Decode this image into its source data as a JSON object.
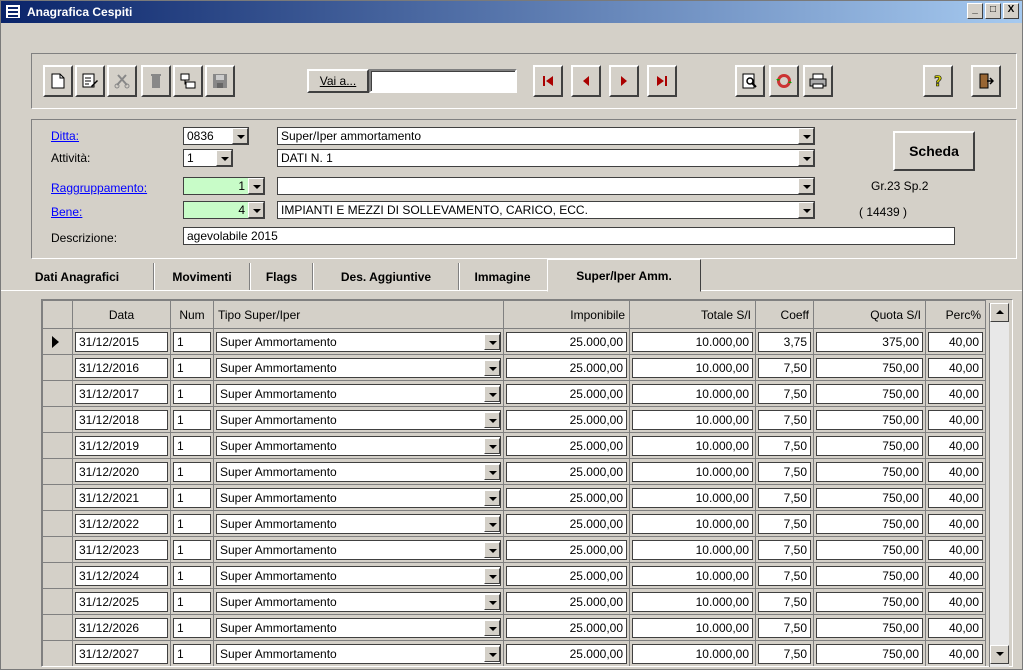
{
  "window": {
    "title": "Anagrafica Cespiti",
    "buttons": [
      "_",
      "□",
      "X"
    ]
  },
  "toolbar": {
    "buttons": [
      {
        "name": "new-icon"
      },
      {
        "name": "edit-icon"
      },
      {
        "name": "cut-icon"
      },
      {
        "name": "trash-icon"
      },
      {
        "name": "duplicate-icon"
      },
      {
        "name": "save-icon"
      }
    ],
    "vai_label": "Vai a...",
    "vai_value": "",
    "nav": [
      "first-record-icon",
      "previous-record-icon",
      "next-record-icon",
      "last-record-icon"
    ],
    "tools": [
      "preview-icon",
      "refresh-icon",
      "print-icon",
      "help-icon",
      "exit-icon"
    ]
  },
  "header": {
    "ditta_label": "Ditta:",
    "ditta_value": "0836",
    "ditta_desc": "Super/Iper ammortamento",
    "attivita_label": "Attività:",
    "attivita_value": "1",
    "attivita_desc": "DATI N.  1",
    "raggruppamento_label": "Raggruppamento:",
    "raggruppamento_value": "1",
    "raggruppamento_desc": "",
    "bene_label": "Bene:",
    "bene_value": "4",
    "bene_desc": "IMPIANTI E MEZZI DI SOLLEVAMENTO, CARICO, ECC.",
    "descrizione_label": "Descrizione:",
    "descrizione_value": "agevolabile 2015",
    "scheda_label": "Scheda",
    "gruppo": "Gr.23 Sp.2",
    "codice": "(      14439     )"
  },
  "tabs": [
    {
      "label": "Dati Anagrafici"
    },
    {
      "label": "Movimenti"
    },
    {
      "label": "Flags"
    },
    {
      "label": "Des. Aggiuntive"
    },
    {
      "label": "Immagine"
    },
    {
      "label": "Super/Iper Amm."
    }
  ],
  "grid": {
    "columns": [
      "Data",
      "Num",
      "Tipo Super/Iper",
      "Imponibile",
      "Totale S/I",
      "Coeff",
      "Quota S/I",
      "Perc%"
    ],
    "rows": [
      {
        "data": "31/12/2015",
        "num": "1",
        "tipo": "Super Ammortamento",
        "imponibile": "25.000,00",
        "totale": "10.000,00",
        "coeff": "3,75",
        "quota": "375,00",
        "perc": "40,00"
      },
      {
        "data": "31/12/2016",
        "num": "1",
        "tipo": "Super Ammortamento",
        "imponibile": "25.000,00",
        "totale": "10.000,00",
        "coeff": "7,50",
        "quota": "750,00",
        "perc": "40,00"
      },
      {
        "data": "31/12/2017",
        "num": "1",
        "tipo": "Super Ammortamento",
        "imponibile": "25.000,00",
        "totale": "10.000,00",
        "coeff": "7,50",
        "quota": "750,00",
        "perc": "40,00"
      },
      {
        "data": "31/12/2018",
        "num": "1",
        "tipo": "Super Ammortamento",
        "imponibile": "25.000,00",
        "totale": "10.000,00",
        "coeff": "7,50",
        "quota": "750,00",
        "perc": "40,00"
      },
      {
        "data": "31/12/2019",
        "num": "1",
        "tipo": "Super Ammortamento",
        "imponibile": "25.000,00",
        "totale": "10.000,00",
        "coeff": "7,50",
        "quota": "750,00",
        "perc": "40,00"
      },
      {
        "data": "31/12/2020",
        "num": "1",
        "tipo": "Super Ammortamento",
        "imponibile": "25.000,00",
        "totale": "10.000,00",
        "coeff": "7,50",
        "quota": "750,00",
        "perc": "40,00"
      },
      {
        "data": "31/12/2021",
        "num": "1",
        "tipo": "Super Ammortamento",
        "imponibile": "25.000,00",
        "totale": "10.000,00",
        "coeff": "7,50",
        "quota": "750,00",
        "perc": "40,00"
      },
      {
        "data": "31/12/2022",
        "num": "1",
        "tipo": "Super Ammortamento",
        "imponibile": "25.000,00",
        "totale": "10.000,00",
        "coeff": "7,50",
        "quota": "750,00",
        "perc": "40,00"
      },
      {
        "data": "31/12/2023",
        "num": "1",
        "tipo": "Super Ammortamento",
        "imponibile": "25.000,00",
        "totale": "10.000,00",
        "coeff": "7,50",
        "quota": "750,00",
        "perc": "40,00"
      },
      {
        "data": "31/12/2024",
        "num": "1",
        "tipo": "Super Ammortamento",
        "imponibile": "25.000,00",
        "totale": "10.000,00",
        "coeff": "7,50",
        "quota": "750,00",
        "perc": "40,00"
      },
      {
        "data": "31/12/2025",
        "num": "1",
        "tipo": "Super Ammortamento",
        "imponibile": "25.000,00",
        "totale": "10.000,00",
        "coeff": "7,50",
        "quota": "750,00",
        "perc": "40,00"
      },
      {
        "data": "31/12/2026",
        "num": "1",
        "tipo": "Super Ammortamento",
        "imponibile": "25.000,00",
        "totale": "10.000,00",
        "coeff": "7,50",
        "quota": "750,00",
        "perc": "40,00"
      },
      {
        "data": "31/12/2027",
        "num": "1",
        "tipo": "Super Ammortamento",
        "imponibile": "25.000,00",
        "totale": "10.000,00",
        "coeff": "7,50",
        "quota": "750,00",
        "perc": "40,00"
      }
    ]
  }
}
